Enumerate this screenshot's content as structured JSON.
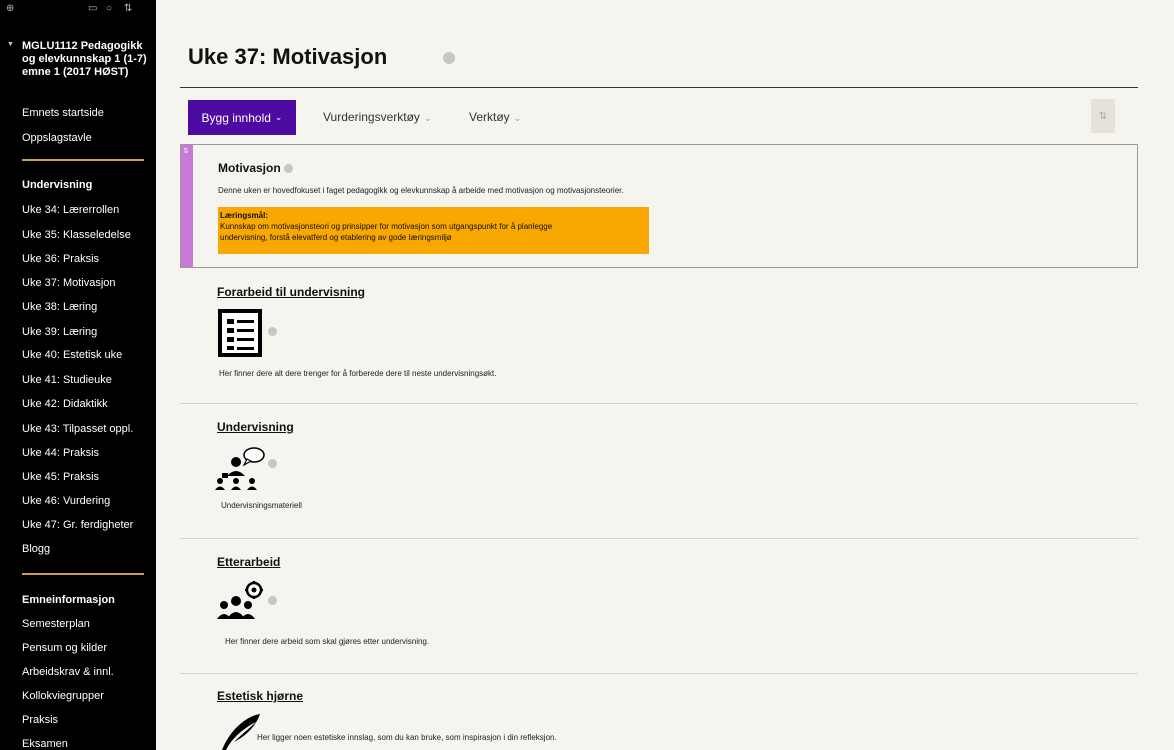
{
  "sidebar": {
    "course_title": "MGLU1112 Pedagogikk og elevkunnskap 1 (1-7) emne 1 (2017 HØST)",
    "links_top": [
      "Emnets startside",
      "Oppslagstavle"
    ],
    "section_teaching": "Undervisning",
    "teaching_items": [
      "Uke 34: Lærerrollen",
      "Uke 35: Klasseledelse",
      "Uke 36: Praksis",
      "Uke 37: Motivasjon",
      "Uke 38: Læring",
      "Uke 39: Læring",
      "Uke 40: Estetisk uke",
      "Uke 41: Studieuke",
      "Uke 42: Didaktikk",
      "Uke 43: Tilpasset oppl.",
      "Uke 44: Praksis",
      "Uke 45: Praksis",
      "Uke 46: Vurdering",
      "Uke 47: Gr. ferdigheter"
    ],
    "blog": "Blogg",
    "section_info": "Emneinformasjon",
    "info_items": [
      "Semesterplan",
      "Pensum og kilder",
      "Arbeidskrav & innl.",
      "Kollokviegrupper",
      "Praksis",
      "Eksamen"
    ]
  },
  "page": {
    "title": "Uke 37: Motivasjon"
  },
  "toolbar": {
    "build_label": "Bygg innhold",
    "assessment_label": "Vurderingsverktøy",
    "tools_label": "Verktøy"
  },
  "items": {
    "motivation": {
      "title": "Motivasjon",
      "text": "Denne uken er hovedfokuset i faget pedagogikk og elevkunnskap å arbeide med motivasjon og motivasjonsteorier.",
      "goal_heading": "Læringsmål:",
      "goal_line1": "Kunnskap om motivasjonsteori og prinsipper for motivasjon som utgangspunkt for å planlegge",
      "goal_line2": "undervisning, forstå elevatferd og etablering av gode læringsmiljø"
    },
    "prework": {
      "title": "Forarbeid til undervisning",
      "text": "Her finner dere alt dere trenger for å forberede dere til neste undervisningsøkt."
    },
    "teaching": {
      "title": "Undervisning",
      "text": "Undervisningsmateriell"
    },
    "afterwork": {
      "title": "Etterarbeid",
      "text": "Her finner dere arbeid som skal gjøres etter undervisning."
    },
    "aesthetic": {
      "title": "Estetisk hjørne",
      "text": "Her ligger noen estetiske innslag, som du kan bruke, som inspirasjon i din refleksjon."
    }
  },
  "colors": {
    "sidebar_bg": "#000000",
    "divider": "#c9a049",
    "build_button": "#4e0ba2",
    "accent": "#c87ad6",
    "goal_box": "#f8a800",
    "page_bg": "#f5f4ef"
  }
}
